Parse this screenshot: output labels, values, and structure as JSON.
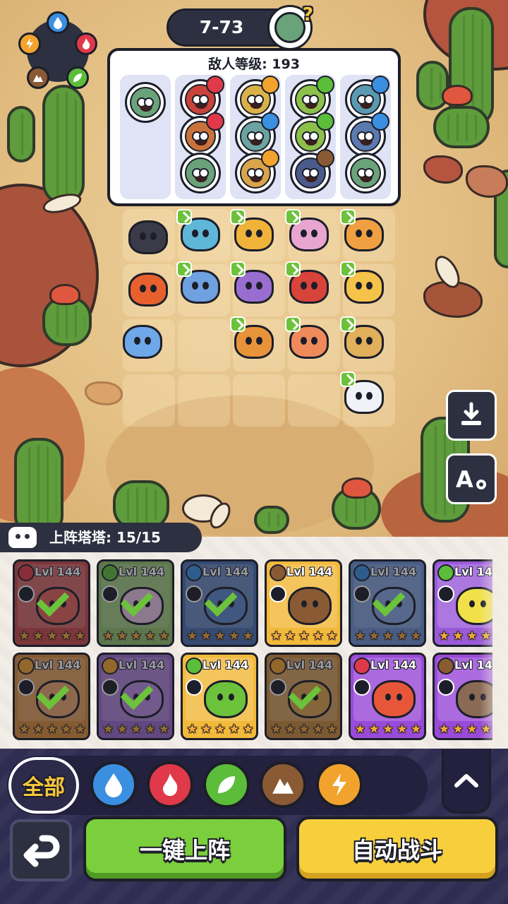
{
  "stage": {
    "label": "7-73"
  },
  "enemy_panel": {
    "level_text": "敌人等级: 193"
  },
  "roster": {
    "title": "上阵塔塔: 15/15",
    "level_text": "Lvl 144"
  },
  "filters": {
    "all_label": "全部",
    "elements": [
      "water",
      "fire",
      "leaf",
      "earth",
      "lightning"
    ]
  },
  "actions": {
    "deploy_label": "一键上阵",
    "auto_battle_label": "自动战斗"
  },
  "colors": {
    "water": "#3b8fe0",
    "fire": "#e0394a",
    "leaf": "#5bbd3a",
    "earth": "#8a5a34",
    "lightning": "#f2a32d"
  }
}
